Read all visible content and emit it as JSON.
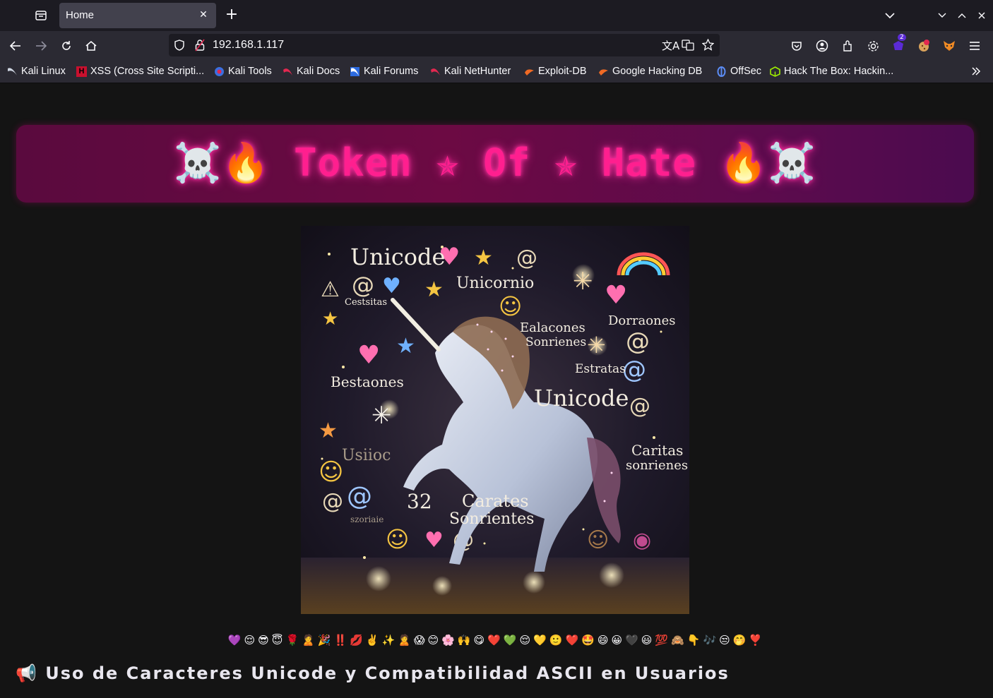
{
  "browser": {
    "tab": {
      "title": "Home",
      "close_icon": "close-icon"
    },
    "url": "192.168.1.117",
    "bookmarks": [
      {
        "label": "Kali Linux",
        "icon": "kali-dragon-icon"
      },
      {
        "label": "XSS (Cross Site Scripti...",
        "icon": "hackerone-icon"
      },
      {
        "label": "Kali Tools",
        "icon": "kali-tools-icon"
      },
      {
        "label": "Kali Docs",
        "icon": "kali-docs-icon"
      },
      {
        "label": "Kali Forums",
        "icon": "kali-forums-icon"
      },
      {
        "label": "Kali NetHunter",
        "icon": "kali-nethunter-icon"
      },
      {
        "label": "Exploit-DB",
        "icon": "exploit-db-icon"
      },
      {
        "label": "Google Hacking DB",
        "icon": "ghdb-icon"
      },
      {
        "label": "OffSec",
        "icon": "offsec-icon"
      },
      {
        "label": "Hack The Box: Hackin...",
        "icon": "htb-icon"
      }
    ],
    "extension_badge": "2"
  },
  "page": {
    "banner_title": "☠️🔥 Token ✯ Of ✯ Hate 🔥☠️",
    "hero_image": {
      "labels": [
        "Unicode",
        "Unicornio",
        "Cestsitas",
        "Ealacones",
        "Sonrienes",
        "Dorraones",
        "Bestaones",
        "Estratas",
        "Unicode",
        "Caritas",
        "sonrienes",
        "Usiioc",
        "32",
        "Carates",
        "Sonrientes",
        "szoriaie"
      ]
    },
    "emoji_row": "💜😌😎😇🌹🙎🎉‼️💋✌️✨🙎😱😊🌸🙌😋❤️💚😌💛🙂❤️🤩😄😀🖤😃💯🙈👇🎶😒🤭❣️",
    "section_heading": "📢 Uso de Caracteres Unicode y Compatibilidad ASCII en Usuarios"
  },
  "colors": {
    "banner_text": "#ff1f8f",
    "banner_bg": "#6c0a43",
    "page_bg": "#141414"
  }
}
